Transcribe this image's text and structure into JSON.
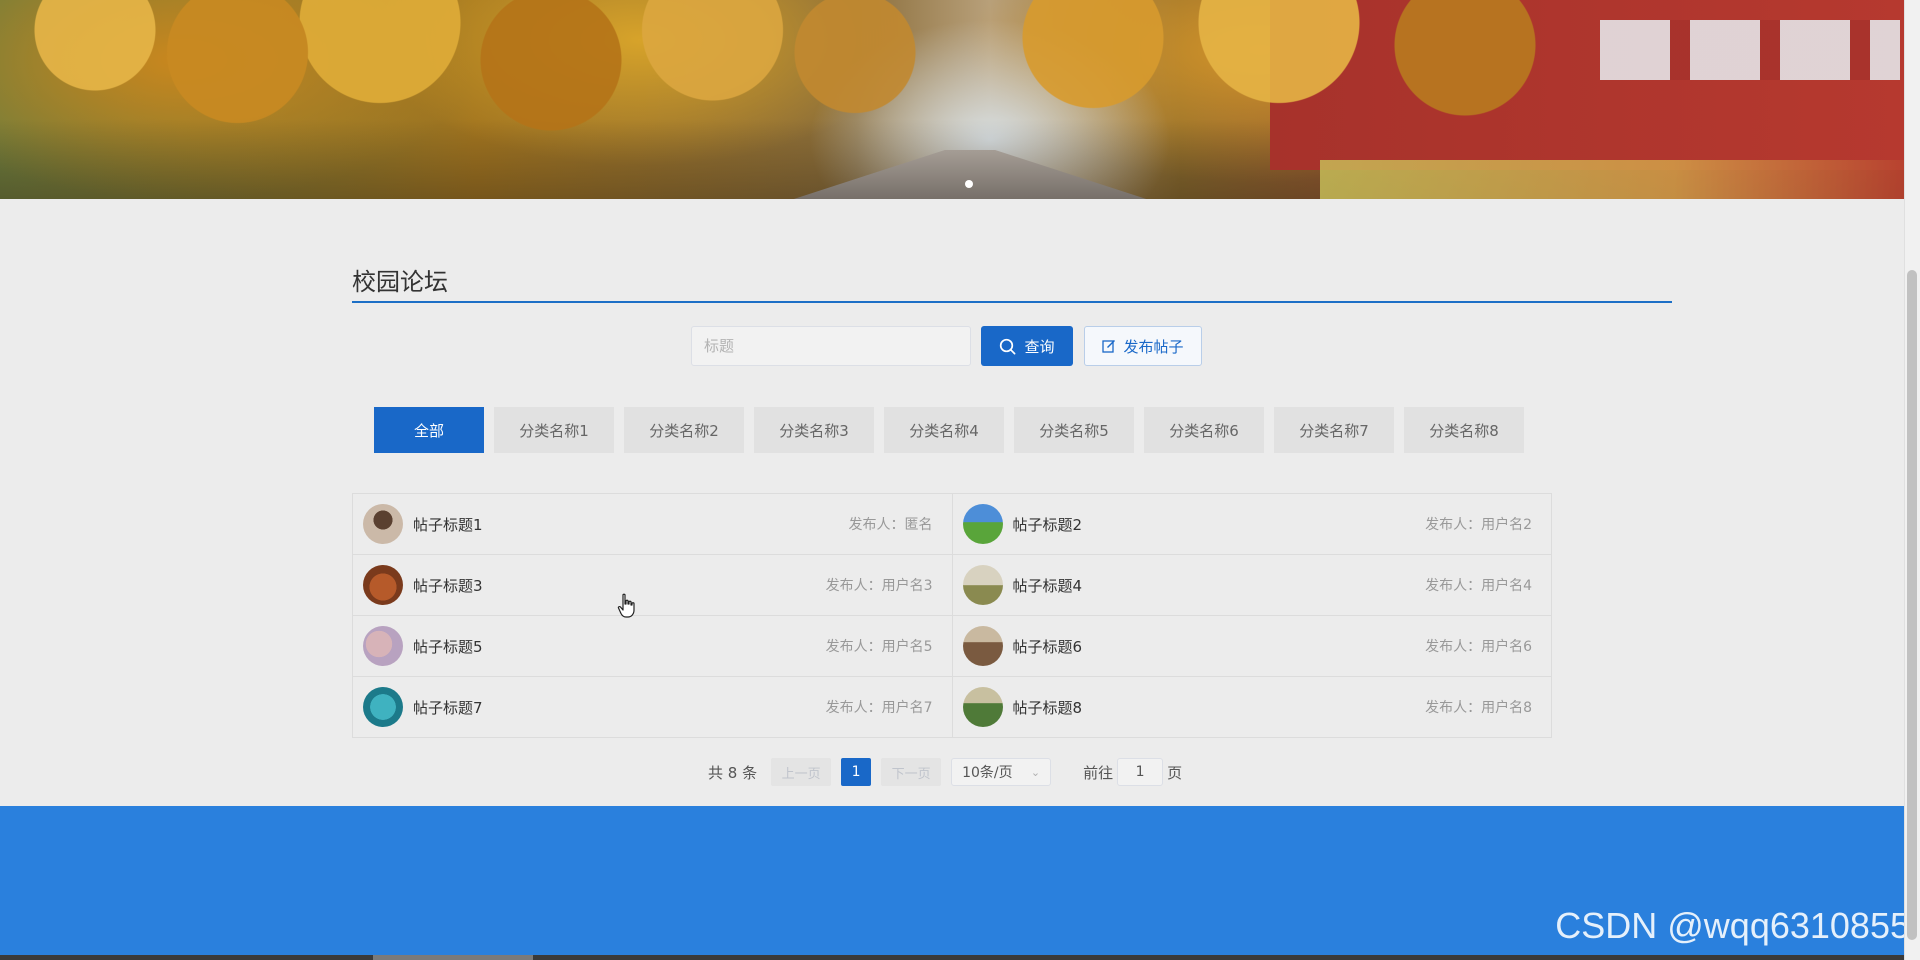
{
  "forum": {
    "title": "校园论坛"
  },
  "search": {
    "placeholder": "标题",
    "value": "",
    "query_label": "查询",
    "post_label": "发布帖子"
  },
  "categories": [
    {
      "label": "全部",
      "active": true
    },
    {
      "label": "分类名称1",
      "active": false
    },
    {
      "label": "分类名称2",
      "active": false
    },
    {
      "label": "分类名称3",
      "active": false
    },
    {
      "label": "分类名称4",
      "active": false
    },
    {
      "label": "分类名称5",
      "active": false
    },
    {
      "label": "分类名称6",
      "active": false
    },
    {
      "label": "分类名称7",
      "active": false
    },
    {
      "label": "分类名称8",
      "active": false
    }
  ],
  "posts": [
    {
      "title": "帖子标题1",
      "author_label": "发布人：",
      "author": "匿名"
    },
    {
      "title": "帖子标题2",
      "author_label": "发布人：",
      "author": "用户名2"
    },
    {
      "title": "帖子标题3",
      "author_label": "发布人：",
      "author": "用户名3"
    },
    {
      "title": "帖子标题4",
      "author_label": "发布人：",
      "author": "用户名4"
    },
    {
      "title": "帖子标题5",
      "author_label": "发布人：",
      "author": "用户名5"
    },
    {
      "title": "帖子标题6",
      "author_label": "发布人：",
      "author": "用户名6"
    },
    {
      "title": "帖子标题7",
      "author_label": "发布人：",
      "author": "用户名7"
    },
    {
      "title": "帖子标题8",
      "author_label": "发布人：",
      "author": "用户名8"
    }
  ],
  "pagination": {
    "total_text": "共 8 条",
    "prev_label": "上一页",
    "current_page": "1",
    "next_label": "下一页",
    "page_size": "10条/页",
    "goto_prefix": "前往",
    "goto_value": "1",
    "goto_suffix": "页"
  },
  "watermark": "CSDN @wqq6310855",
  "colors": {
    "primary": "#1968c8",
    "footer": "#2a80dd",
    "title_line": "#1c6fc6"
  }
}
